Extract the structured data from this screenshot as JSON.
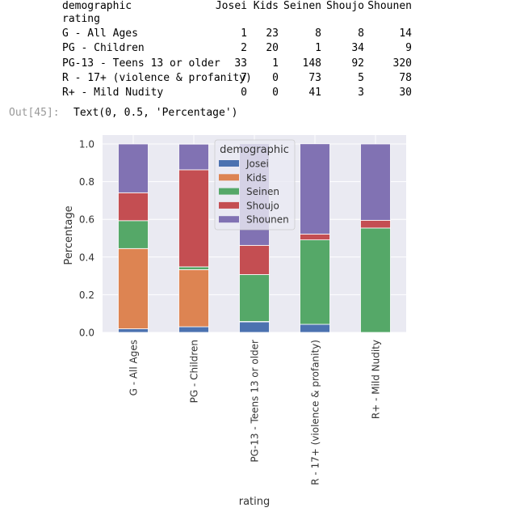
{
  "table": {
    "columns_label": "demographic",
    "index_label": "rating",
    "columns": [
      "Josei",
      "Kids",
      "Seinen",
      "Shoujo",
      "Shounen"
    ],
    "rows": [
      {
        "label": "G - All Ages",
        "values": [
          "1",
          "23",
          "8",
          "8",
          "14"
        ]
      },
      {
        "label": "PG - Children",
        "values": [
          "2",
          "20",
          "1",
          "34",
          "9"
        ]
      },
      {
        "label": "PG-13 - Teens 13 or older",
        "values": [
          "33",
          "1",
          "148",
          "92",
          "320"
        ]
      },
      {
        "label": "R - 17+ (violence & profanity)",
        "values": [
          "7",
          "0",
          "73",
          "5",
          "78"
        ]
      },
      {
        "label": "R+ - Mild Nudity",
        "values": [
          "0",
          "0",
          "41",
          "3",
          "30"
        ]
      }
    ]
  },
  "output": {
    "prompt": "Out[45]:",
    "text": "Text(0, 0.5, 'Percentage')"
  },
  "chart_data": {
    "type": "bar",
    "stacked": true,
    "categories": [
      "G - All Ages",
      "PG - Children",
      "PG-13 - Teens 13 or older",
      "R - 17+ (violence & profanity)",
      "R+ - Mild Nudity"
    ],
    "series": [
      {
        "name": "Josei",
        "color": "#4c72b0",
        "values": [
          0.019,
          0.03,
          0.056,
          0.043,
          0.0
        ]
      },
      {
        "name": "Kids",
        "color": "#dd8452",
        "values": [
          0.426,
          0.303,
          0.002,
          0.0,
          0.0
        ]
      },
      {
        "name": "Seinen",
        "color": "#55a868",
        "values": [
          0.148,
          0.015,
          0.249,
          0.448,
          0.554
        ]
      },
      {
        "name": "Shoujo",
        "color": "#c44e52",
        "values": [
          0.148,
          0.515,
          0.155,
          0.031,
          0.041
        ]
      },
      {
        "name": "Shounen",
        "color": "#8172b3",
        "values": [
          0.259,
          0.136,
          0.539,
          0.479,
          0.405
        ]
      }
    ],
    "xlabel": "rating",
    "ylabel": "Percentage",
    "ylim": [
      0,
      1.05
    ],
    "yticks": [
      "0.0",
      "0.2",
      "0.4",
      "0.6",
      "0.8",
      "1.0"
    ],
    "legend": {
      "title": "demographic",
      "placement": "top-center"
    },
    "grid": true,
    "background": "#eaeaf2"
  }
}
